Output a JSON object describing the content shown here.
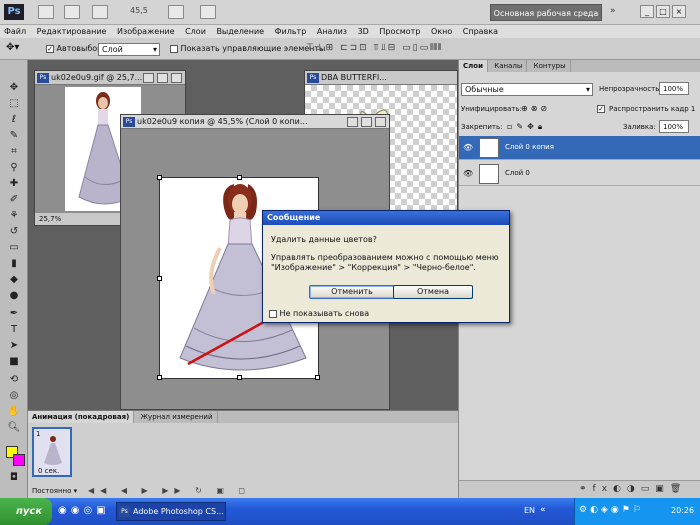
{
  "topbar": {
    "logo": "Ps",
    "zoom": "45,5",
    "workspace": "Основная рабочая среда",
    "more": "»"
  },
  "menu": [
    "Файл",
    "Редактирование",
    "Изображение",
    "Слои",
    "Выделение",
    "Фильтр",
    "Анализ",
    "3D",
    "Просмотр",
    "Окно",
    "Справка"
  ],
  "options": {
    "autoselect_label": "Автовыбор:",
    "autoselect_value": "Слой",
    "show_controls_label": "Показать управляющие элементы"
  },
  "documents": [
    {
      "title": "uk02e0u9.gif @ 25,7...",
      "zoom": "25,7%"
    },
    {
      "title": "uk02e0u9 копия @ 45,5% (Слой 0 копи..."
    },
    {
      "title": "DBA BUTTERFI..."
    }
  ],
  "layers_panel": {
    "tabs": [
      "Слои",
      "Каналы",
      "Контуры"
    ],
    "blend_mode": "Обычные",
    "opacity_label": "Непрозрачность:",
    "opacity_value": "100%",
    "unify_label": "Унифицировать:",
    "propagate_label": "Распространить кадр 1",
    "lock_label": "Закрепить:",
    "fill_label": "Заливка:",
    "fill_value": "100%",
    "layers": [
      {
        "name": "Слой 0 копия",
        "selected": true
      },
      {
        "name": "Слой 0",
        "selected": false
      }
    ]
  },
  "animation_panel": {
    "tabs": [
      "Анимация (покадровая)",
      "Журнал измерений"
    ],
    "frame_number": "1",
    "frame_time": "0 сек.",
    "loop": "Постоянно"
  },
  "dialog": {
    "title": "Сообщение",
    "question": "Удалить данные цветов?",
    "hint": "Управлять преобразованием можно с помощью меню \"Изображение\" > \"Коррекция\" > \"Черно-белое\".",
    "cancel_button": "Отменить",
    "abort_button": "Отмена",
    "dont_show": "Не показывать снова"
  },
  "taskbar": {
    "start": "пуск",
    "task": "Adobe Photoshop CS...",
    "lang": "EN",
    "clock": "20:26"
  },
  "colors": {
    "foreground": "#ffff00",
    "background": "#ff00ff",
    "arrow": "#d01010",
    "selected_layer": "#3369b7"
  }
}
